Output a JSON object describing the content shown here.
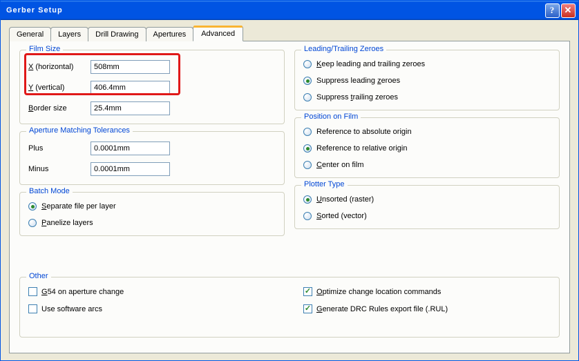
{
  "title": "Gerber Setup",
  "tabs": [
    "General",
    "Layers",
    "Drill Drawing",
    "Apertures",
    "Advanced"
  ],
  "activeTabIndex": 4,
  "filmSize": {
    "title": "Film Size",
    "xLabel_pre": "X",
    "xLabel_post": " (horizontal)",
    "xValue": "508mm",
    "yLabel_pre": "Y",
    "yLabel_post": " (vertical)",
    "yValue": "406.4mm",
    "borderLabel_pre": "B",
    "borderLabel_post": "order size",
    "borderValue": "25.4mm"
  },
  "aperture": {
    "title": "Aperture Matching Tolerances",
    "plusLabel": "Plus",
    "plusValue": "0.0001mm",
    "minusLabel": "Minus",
    "minusValue": "0.0001mm"
  },
  "batch": {
    "title": "Batch Mode",
    "opt1_pre": "S",
    "opt1_post": "eparate file per layer",
    "opt2_pre": "P",
    "opt2_post": "anelize layers",
    "selected": 0
  },
  "other": {
    "title": "Other",
    "g54_pre": "G",
    "g54_post": "54 on aperture change",
    "g54_checked": false,
    "arcs": "Use software arcs",
    "arcs_checked": false,
    "opt_pre": "O",
    "opt_post": "ptimize change location commands",
    "opt_checked": true,
    "gen_pre": "G",
    "gen_post": "enerate DRC Rules export file (.RUL)",
    "gen_checked": true
  },
  "zeroes": {
    "title": "Leading/Trailing Zeroes",
    "opt1_pre": "K",
    "opt1_post": "eep leading and trailing zeroes",
    "opt2_pre1": "Suppress leading ",
    "opt2_u": "z",
    "opt2_post2": "eroes",
    "opt3_pre1": "Suppress ",
    "opt3_u": "t",
    "opt3_post2": "railing zeroes",
    "selected": 1
  },
  "position": {
    "title": "Position on Film",
    "opt1": "Reference to absolute origin",
    "opt2": "Reference to relative origin",
    "opt3_pre": "C",
    "opt3_post": "enter on film",
    "selected": 1
  },
  "plotter": {
    "title": "Plotter Type",
    "opt1_pre": "U",
    "opt1_post": "nsorted (raster)",
    "opt2_pre": "S",
    "opt2_post": "orted (vector)",
    "selected": 0
  }
}
